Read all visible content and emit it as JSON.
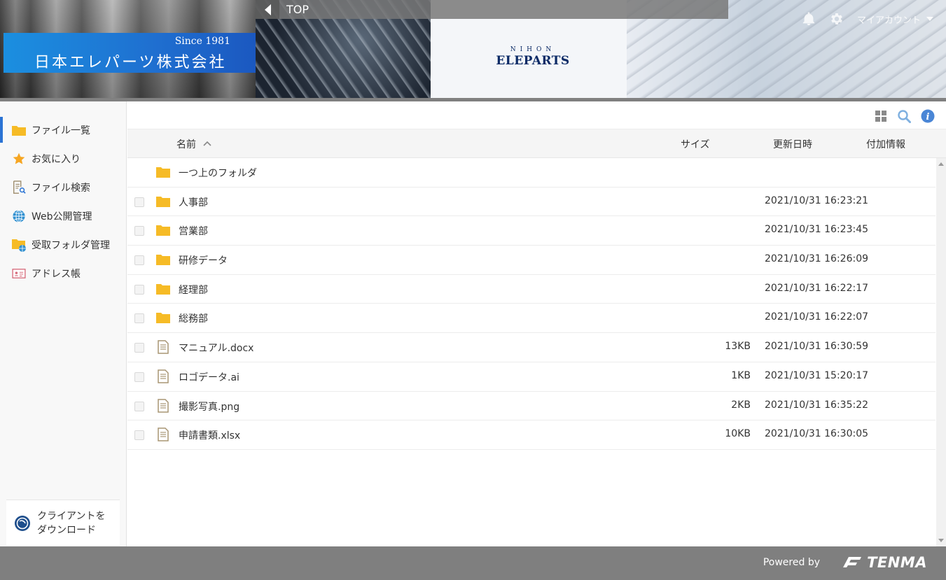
{
  "header": {
    "company_since": "Since 1981",
    "company_name": "日本エレパーツ株式会社",
    "brand_line1": "NIHON",
    "brand_line2": "ELEPARTS",
    "location": "TOP",
    "account_label": "マイアカウント"
  },
  "sidebar": {
    "items": [
      {
        "label": "ファイル一覧",
        "icon": "folder-icon",
        "active": true
      },
      {
        "label": "お気に入り",
        "icon": "star-icon"
      },
      {
        "label": "ファイル検索",
        "icon": "file-search-icon"
      },
      {
        "label": "Web公開管理",
        "icon": "globe-icon"
      },
      {
        "label": "受取フォルダ管理",
        "icon": "receive-folder-icon"
      },
      {
        "label": "アドレス帳",
        "icon": "address-book-icon"
      }
    ],
    "client_download_line1": "クライアントを",
    "client_download_line2": "ダウンロード"
  },
  "columns": {
    "name": "名前",
    "size": "サイズ",
    "modified": "更新日時",
    "extra": "付加情報"
  },
  "parent_folder_label": "一つ上のフォルダ",
  "files": [
    {
      "name": "人事部",
      "type": "folder",
      "size": "",
      "modified": "2021/10/31 16:23:21"
    },
    {
      "name": "営業部",
      "type": "folder",
      "size": "",
      "modified": "2021/10/31 16:23:45"
    },
    {
      "name": "研修データ",
      "type": "folder",
      "size": "",
      "modified": "2021/10/31 16:26:09"
    },
    {
      "name": "経理部",
      "type": "folder",
      "size": "",
      "modified": "2021/10/31 16:22:17"
    },
    {
      "name": "総務部",
      "type": "folder",
      "size": "",
      "modified": "2021/10/31 16:22:07"
    },
    {
      "name": "マニュアル.docx",
      "type": "file",
      "size": "13KB",
      "modified": "2021/10/31 16:30:59"
    },
    {
      "name": "ロゴデータ.ai",
      "type": "file",
      "size": "1KB",
      "modified": "2021/10/31 15:20:17"
    },
    {
      "name": "撮影写真.png",
      "type": "file",
      "size": "2KB",
      "modified": "2021/10/31 16:35:22"
    },
    {
      "name": "申請書類.xlsx",
      "type": "file",
      "size": "10KB",
      "modified": "2021/10/31 16:30:05"
    }
  ],
  "footer": {
    "powered_by": "Powered by",
    "brand": "TENMA"
  },
  "colors": {
    "accent": "#2b73d4",
    "folder": "#f6bb26",
    "info": "#4a86d6",
    "footer": "#7f7f7f"
  }
}
